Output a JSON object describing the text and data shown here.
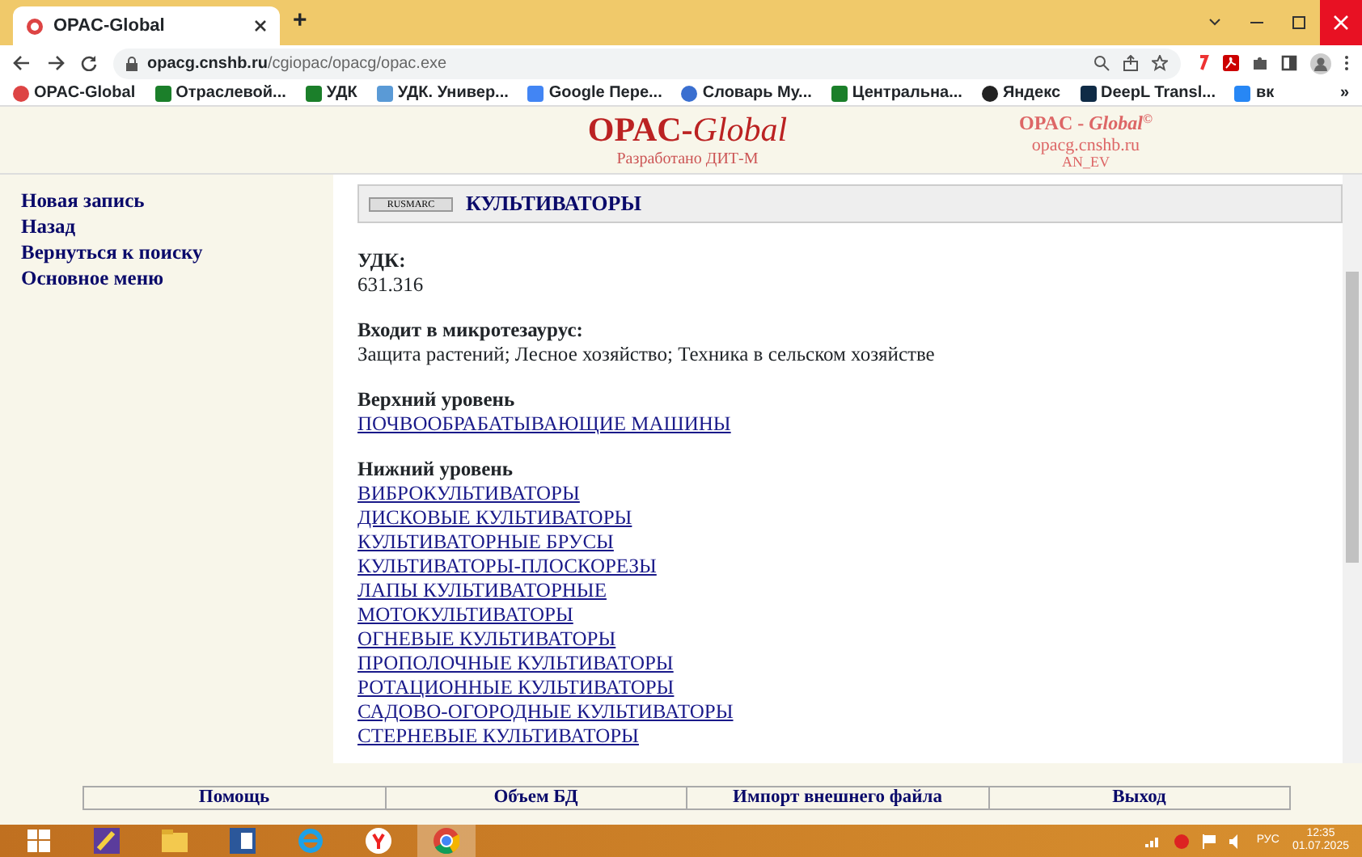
{
  "browser": {
    "tab_title": "OPAC-Global",
    "new_tab": "+",
    "url_host": "opacg.cnshb.ru",
    "url_path": "/cgiopac/opacg/opac.exe",
    "bookmarks": [
      {
        "label": "OPAC-Global",
        "kind": "opac"
      },
      {
        "label": "Отраслевой...",
        "kind": "green"
      },
      {
        "label": "УДК",
        "kind": "green"
      },
      {
        "label": "УДК. Универ...",
        "kind": "arrow"
      },
      {
        "label": "Google Пере...",
        "kind": "translate"
      },
      {
        "label": "Словарь Му...",
        "kind": "globe"
      },
      {
        "label": "Центральна...",
        "kind": "green"
      },
      {
        "label": "Яндекс",
        "kind": "plus"
      },
      {
        "label": "DeepL Transl...",
        "kind": "deepl"
      },
      {
        "label": "вк",
        "kind": "vk"
      }
    ],
    "more": "»"
  },
  "header": {
    "logo_left": "OPAC-",
    "logo_right": "Global",
    "subtitle": "Разработано ДИТ-М",
    "corner_title": "OPAC - ",
    "corner_title_italic": "Global",
    "corner_mark": "©",
    "corner_host": "opacg.cnshb.ru",
    "corner_author": "AN_EV"
  },
  "sidebar": {
    "items": [
      "Новая запись",
      "Назад",
      "Вернуться к поиску",
      "Основное меню"
    ]
  },
  "record": {
    "badge": "RUSMARC",
    "title": "КУЛЬТИВАТОРЫ",
    "sections": [
      {
        "heading": "УДК:",
        "kind": "text",
        "items": [
          "631.316"
        ]
      },
      {
        "heading": "Входит в микротезаурус:",
        "kind": "text",
        "items": [
          "Защита растений; Лесное хозяйство; Техника в сельском хозяйстве"
        ]
      },
      {
        "heading": "Верхний уровень",
        "kind": "links",
        "items": [
          "ПОЧВООБРАБАТЫВАЮЩИЕ МАШИНЫ"
        ]
      },
      {
        "heading": "Нижний уровень",
        "kind": "links",
        "items": [
          "ВИБРОКУЛЬТИВАТОРЫ",
          "ДИСКОВЫЕ КУЛЬТИВАТОРЫ",
          "КУЛЬТИВАТОРНЫЕ БРУСЫ",
          "КУЛЬТИВАТОРЫ-ПЛОСКОРЕЗЫ",
          "ЛАПЫ КУЛЬТИВАТОРНЫЕ",
          "МОТОКУЛЬТИВАТОРЫ",
          "ОГНЕВЫЕ КУЛЬТИВАТОРЫ",
          "ПРОПОЛОЧНЫЕ КУЛЬТИВАТОРЫ",
          "РОТАЦИОННЫЕ КУЛЬТИВАТОРЫ",
          "САДОВО-ОГОРОДНЫЕ КУЛЬТИВАТОРЫ",
          "СТЕРНЕВЫЕ КУЛЬТИВАТОРЫ"
        ]
      }
    ]
  },
  "footer": {
    "buttons": [
      "Помощь",
      "Объем БД",
      "Импорт внешнего файла",
      "Выход"
    ]
  },
  "taskbar": {
    "apps": [
      {
        "kind": "start"
      },
      {
        "kind": "pen"
      },
      {
        "kind": "folder"
      },
      {
        "kind": "word"
      },
      {
        "kind": "ie"
      },
      {
        "kind": "yandex"
      },
      {
        "kind": "chrome",
        "selected": true
      }
    ],
    "lang": "РУС",
    "time": "12:35",
    "date": "01.07.2025"
  }
}
